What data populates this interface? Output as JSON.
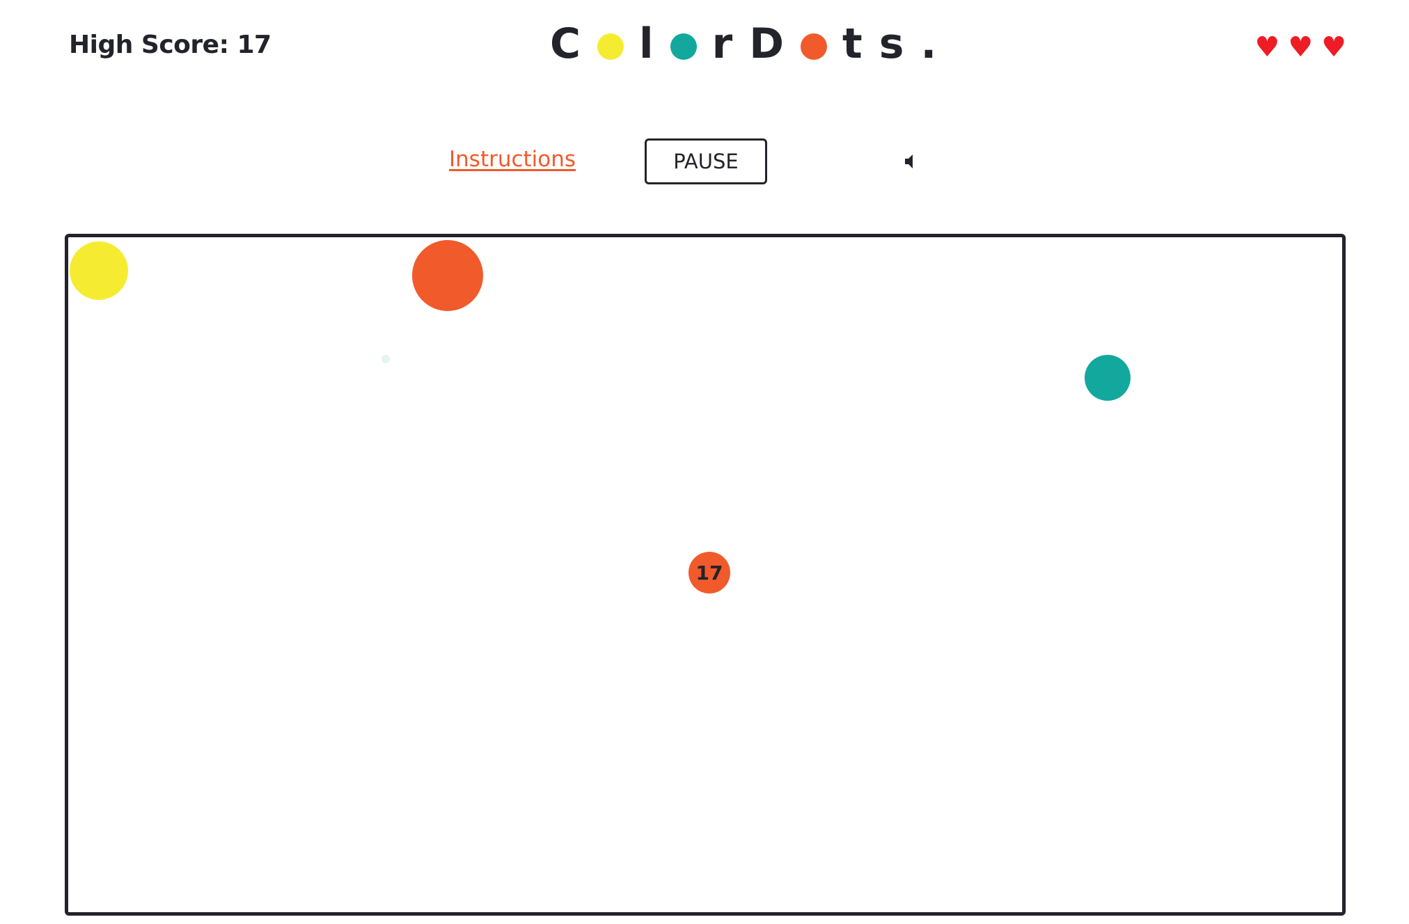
{
  "header": {
    "high_score_label": "High Score: 17",
    "logo": {
      "parts": [
        "C",
        "l",
        "r",
        "D",
        "t",
        "s"
      ],
      "period": ".",
      "dot_colors": [
        "#f5ec32",
        "#13a89e",
        "#f15a2b"
      ]
    },
    "lives": 3,
    "heart_glyph": "♥",
    "heart_color": "#ee1c25"
  },
  "controls": {
    "instructions_label": "Instructions",
    "pause_label": "PAUSE",
    "sound_icon": "speaker-icon"
  },
  "game": {
    "player": {
      "score": "17",
      "color": "#f15a2b"
    },
    "colors": {
      "yellow": "#f5ec32",
      "orange": "#f15a2b",
      "teal": "#13a89e",
      "faint_teal": "#e3f5f2",
      "border": "#23232b"
    }
  }
}
